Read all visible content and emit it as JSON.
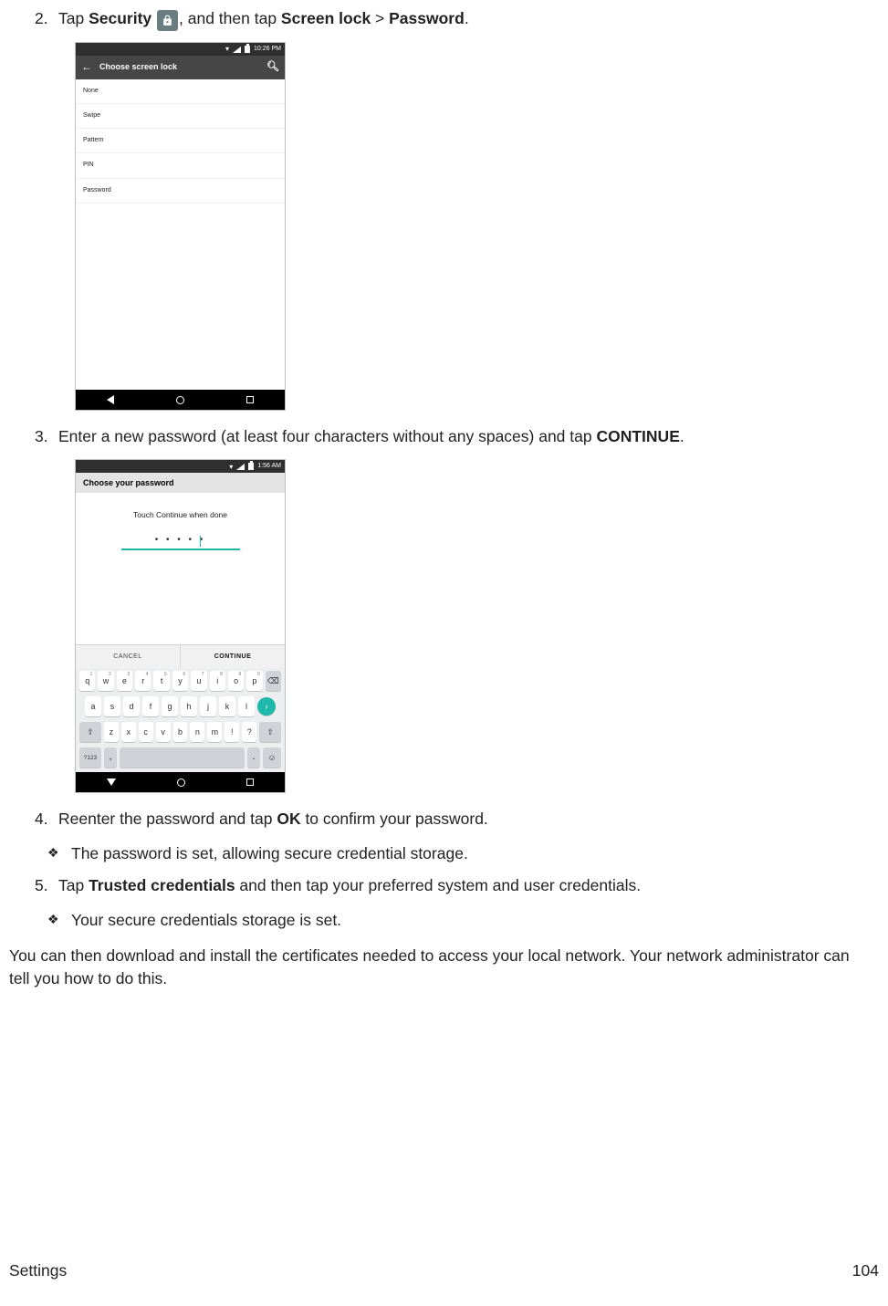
{
  "steps": {
    "s2": {
      "num": "2.",
      "pre": "Tap ",
      "security": "Security",
      "mid": ", and then tap ",
      "screenlock": "Screen lock",
      "gt": " > ",
      "password": "Password",
      "end": "."
    },
    "s3": {
      "num": "3.",
      "pre": "Enter a new password (at least four characters without any spaces) and tap ",
      "cont": "CONTINUE",
      "end": "."
    },
    "s4": {
      "num": "4.",
      "pre": "Reenter the password and tap ",
      "ok": "OK",
      "end": " to confirm your password."
    },
    "s5": {
      "num": "5.",
      "pre": "Tap ",
      "tc": "Trusted credentials",
      "end": " and then tap your preferred system and user credentials."
    }
  },
  "subs": {
    "a": "The password is set, allowing secure credential storage.",
    "b": "Your secure credentials storage is set."
  },
  "para": "You can then download and install the certificates needed to access your local network. Your network administrator can tell you how to do this.",
  "footer": {
    "left": "Settings",
    "right": "104"
  },
  "phone1": {
    "time": "10:26 PM",
    "header": "Choose screen lock",
    "items": [
      "None",
      "Swipe",
      "Pattern",
      "PIN",
      "Password"
    ]
  },
  "phone2": {
    "time": "1:56 AM",
    "header": "Choose your password",
    "hint": "Touch Continue when done",
    "dots": "• • • • •",
    "cancel": "CANCEL",
    "cont": "CONTINUE",
    "kbd": {
      "r1": [
        [
          "q",
          "1"
        ],
        [
          "w",
          "2"
        ],
        [
          "e",
          "3"
        ],
        [
          "r",
          "4"
        ],
        [
          "t",
          "5"
        ],
        [
          "y",
          "6"
        ],
        [
          "u",
          "7"
        ],
        [
          "i",
          "8"
        ],
        [
          "o",
          "9"
        ],
        [
          "p",
          "0"
        ]
      ],
      "r2": [
        "a",
        "s",
        "d",
        "f",
        "g",
        "h",
        "j",
        "k",
        "l"
      ],
      "r3": [
        "z",
        "x",
        "c",
        "v",
        "b",
        "n",
        "m",
        "!",
        "?"
      ],
      "sym": "?123"
    }
  }
}
